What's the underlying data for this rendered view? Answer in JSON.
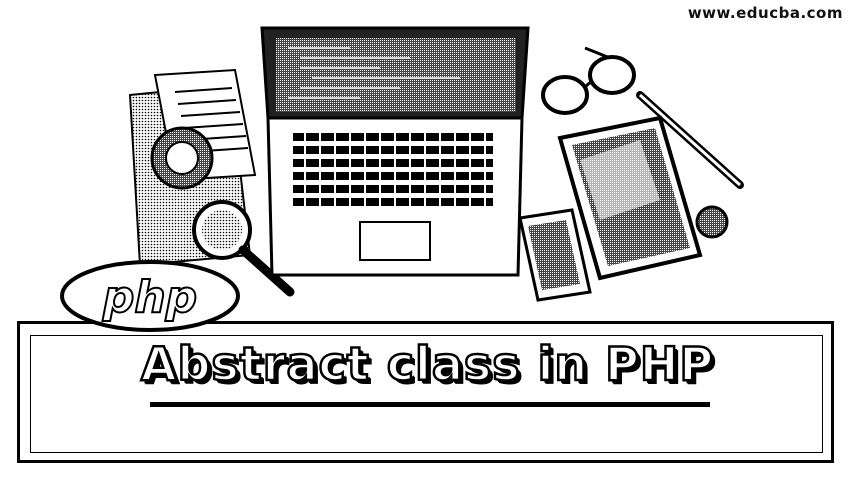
{
  "header": {
    "site_url": "www.educba.com"
  },
  "banner": {
    "title": "Abstract class in PHP"
  },
  "logo": {
    "text": "php"
  },
  "icons": [
    "laptop-icon",
    "papers-icon",
    "magnifier-icon",
    "eyeglasses-icon",
    "tablet-icon",
    "smartphone-icon",
    "pencil-icon",
    "php-logo"
  ]
}
